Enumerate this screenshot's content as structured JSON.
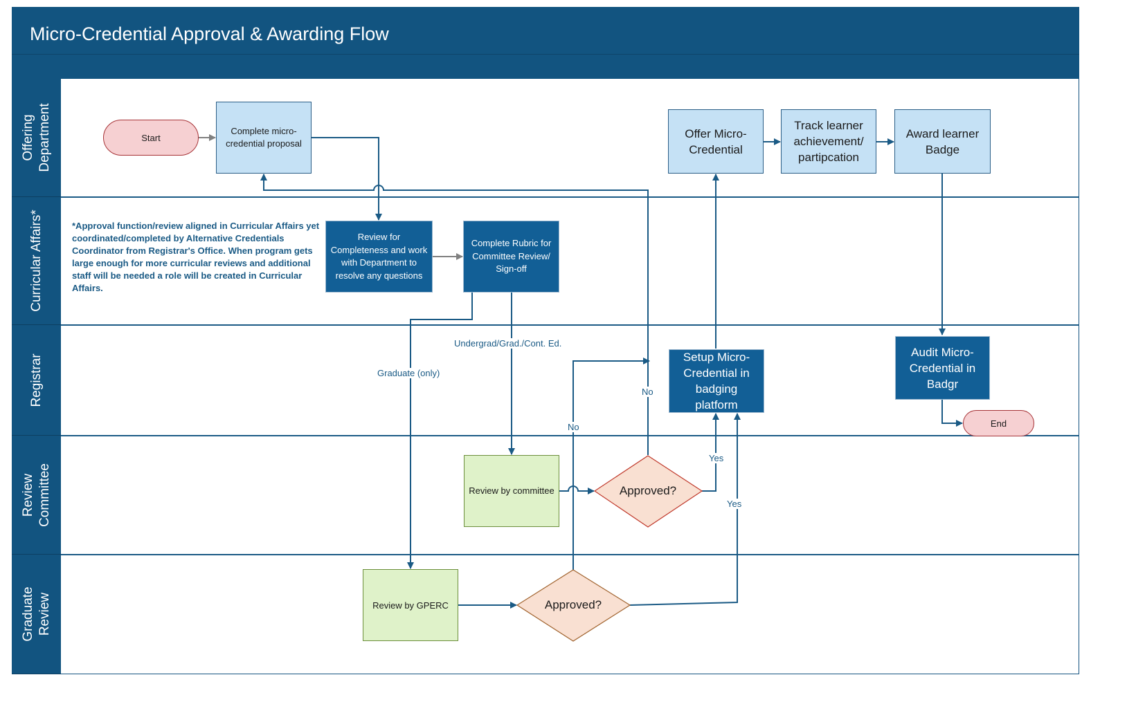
{
  "header": {
    "title": "Micro-Credential Approval & Awarding Flow"
  },
  "lanes": [
    {
      "id": "offering",
      "label": "Offering\nDepartment"
    },
    {
      "id": "curricular",
      "label": "Curricular Affairs*"
    },
    {
      "id": "registrar",
      "label": "Registrar"
    },
    {
      "id": "committee",
      "label": "Review\nCommittee"
    },
    {
      "id": "graduate",
      "label": "Graduate\nReview"
    }
  ],
  "nodes": {
    "start": "Start",
    "proposal": "Complete micro-credential proposal",
    "offer": "Offer Micro-Credential",
    "track": "Track learner achievement/ partipcation",
    "award": "Award learner Badge",
    "review_completeness": "Review for Completeness and work with Department to resolve any questions",
    "rubric": "Complete Rubric for Committee Review/ Sign-off",
    "setup": "Setup Micro-Credential in badging platform",
    "audit": "Audit Micro-Credential in Badgr",
    "end": "End",
    "review_committee": "Review by committee",
    "approved_committee": "Approved?",
    "review_gperc": "Review by GPERC",
    "approved_graduate": "Approved?"
  },
  "note": "*Approval function/review aligned in Curricular Affairs yet coordinated/completed by Alternative Credentials Coordinator from Registrar's Office.  When program gets large enough for more curricular reviews and additional staff will be needed a role will be created in Curricular Affairs.",
  "edge_labels": {
    "undergrad": "Undergrad/Grad./Cont. Ed.",
    "graduate_only": "Graduate (only)",
    "no_committee": "No",
    "no_graduate": "No",
    "yes_committee": "Yes",
    "yes_graduate": "Yes"
  },
  "colors": {
    "header": "#125480",
    "connector": "#1a5a85",
    "light_box": "#c5e1f5",
    "dark_box": "#125f96",
    "green_box": "#dff2c9",
    "decision": "#f9e0d2",
    "terminal": "#f6d0d2"
  }
}
